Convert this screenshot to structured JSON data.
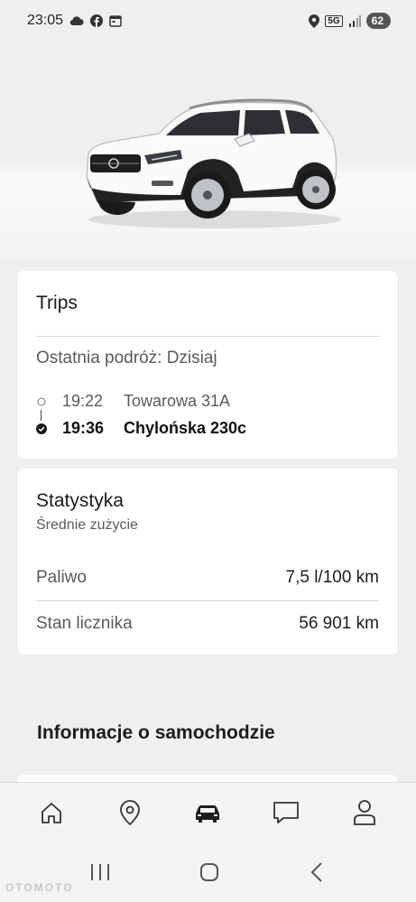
{
  "status_bar": {
    "time": "23:05",
    "network": "5G",
    "battery": "62"
  },
  "trips": {
    "title": "Trips",
    "last_trip": "Ostatnia podróż: Dzisiaj",
    "start": {
      "time": "19:22",
      "address": "Towarowa 31A"
    },
    "end": {
      "time": "19:36",
      "address": "Chylońska 230c"
    }
  },
  "stats": {
    "title": "Statystyka",
    "subtitle": "Średnie zużycie",
    "rows": [
      {
        "label": "Paliwo",
        "value": "7,5 l/100 km"
      },
      {
        "label": "Stan licznika",
        "value": "56 901 km"
      }
    ]
  },
  "info_section": {
    "title": "Informacje o samochodzie"
  },
  "bottom_nav": [
    {
      "icon": "home-icon",
      "active": false
    },
    {
      "icon": "location-pin-icon",
      "active": false
    },
    {
      "icon": "car-icon",
      "active": true
    },
    {
      "icon": "chat-icon",
      "active": false
    },
    {
      "icon": "profile-icon",
      "active": false
    }
  ],
  "watermark": "OTOMOTO",
  "colors": {
    "background": "#efefef",
    "card": "#ffffff",
    "text_primary": "#1c1c1c",
    "text_secondary": "#5a5a5a"
  }
}
